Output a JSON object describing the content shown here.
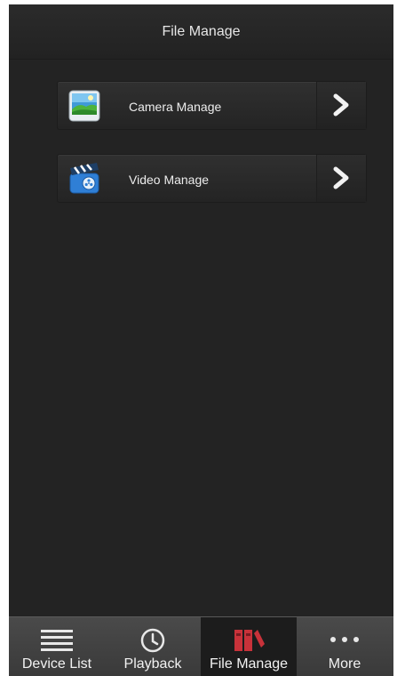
{
  "header": {
    "title": "File Manage"
  },
  "menu": [
    {
      "label": "Camera Manage",
      "icon": "photo-landscape-icon"
    },
    {
      "label": "Video Manage",
      "icon": "video-clapper-icon"
    }
  ],
  "tabs": [
    {
      "label": "Device List",
      "icon": "list-icon",
      "active": false
    },
    {
      "label": "Playback",
      "icon": "clock-icon",
      "active": false
    },
    {
      "label": "File Manage",
      "icon": "folders-icon",
      "active": true
    },
    {
      "label": "More",
      "icon": "more-dots-icon",
      "active": false
    }
  ],
  "colors": {
    "accent": "#c8323a",
    "background": "#232323",
    "tabbar": "#434343"
  }
}
